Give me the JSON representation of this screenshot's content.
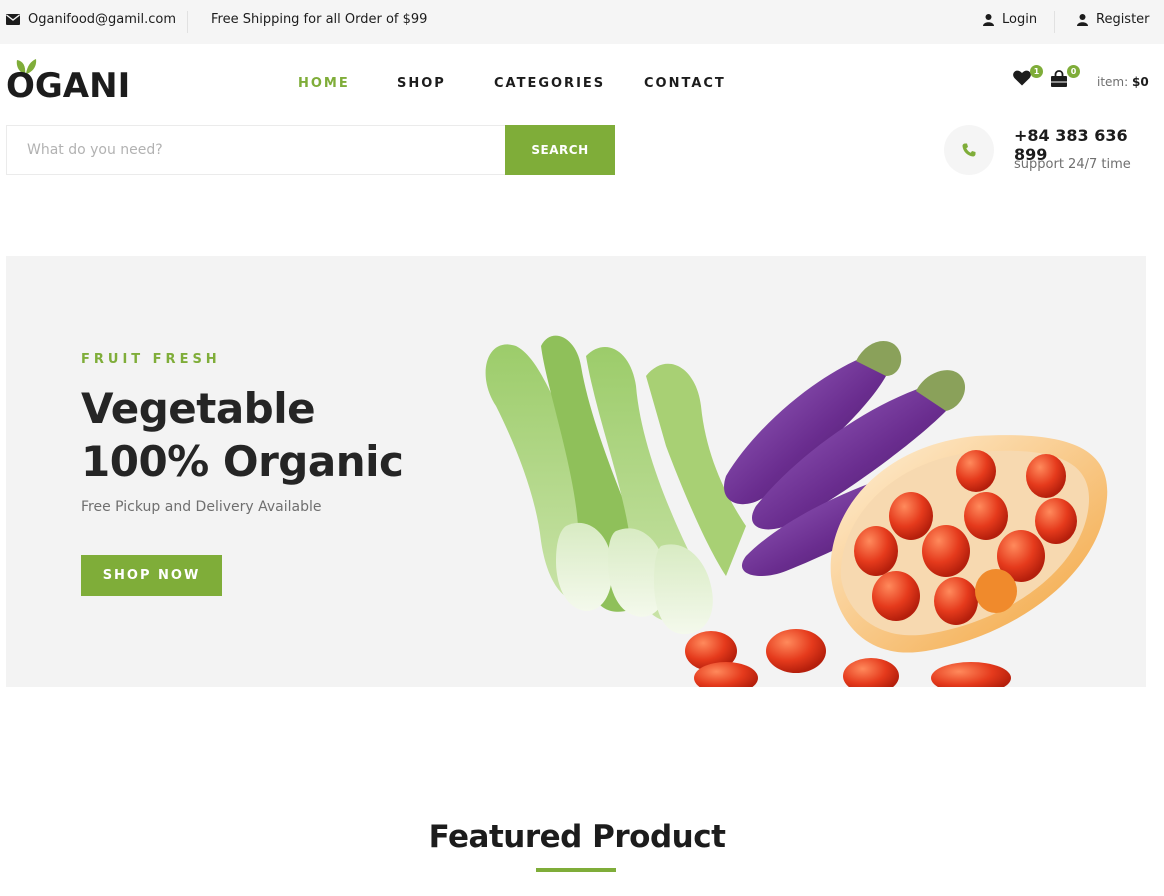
{
  "topbar": {
    "email": "Oganifood@gamil.com",
    "shipping": "Free Shipping for all Order of $99",
    "login": "Login",
    "register": "Register"
  },
  "header": {
    "logo": "OGANI",
    "nav": [
      "HOME",
      "SHOP",
      "CATEGORIES",
      "CONTACT"
    ],
    "active_nav": "HOME",
    "wishlist_count": "1",
    "cart_count": "0",
    "cart_label": "item:",
    "cart_total": "$0"
  },
  "search": {
    "placeholder": "What do you need?",
    "button": "SEARCH"
  },
  "contact": {
    "phone": "+84 383 636 899",
    "support": "support 24/7 time"
  },
  "hero": {
    "eyebrow": "FRUIT FRESH",
    "headline_line1": "Vegetable",
    "headline_line2": "100% Organic",
    "subtitle": "Free Pickup and Delivery Available",
    "cta": "SHOP NOW"
  },
  "featured": {
    "title": "Featured Product"
  },
  "colors": {
    "accent": "#7fad39",
    "topbar_bg": "#f5f5f5",
    "hero_bg": "#f3f3f3",
    "text_dark": "#1c1c1c"
  },
  "icons": {
    "email": "envelope-icon",
    "user": "user-icon",
    "wishlist": "heart-icon",
    "cart": "shopping-bag-icon",
    "phone": "phone-icon",
    "logo_leaf": "leaf-icon"
  }
}
